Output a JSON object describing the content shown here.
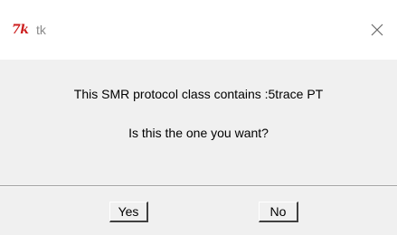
{
  "window": {
    "title": "tk",
    "logo_text": "7k",
    "close_glyph": "×"
  },
  "dialog": {
    "message": "This SMR protocol class contains :5trace PT",
    "question": "Is this the one you want?"
  },
  "buttons": {
    "yes_label": "Yes",
    "no_label": "No"
  },
  "icons": {
    "app": "tk-feather-icon",
    "close": "close-icon"
  },
  "colors": {
    "logo": "#cc1e1e",
    "title_text": "#8a8a8a",
    "body_bg": "#f0f0f0"
  }
}
